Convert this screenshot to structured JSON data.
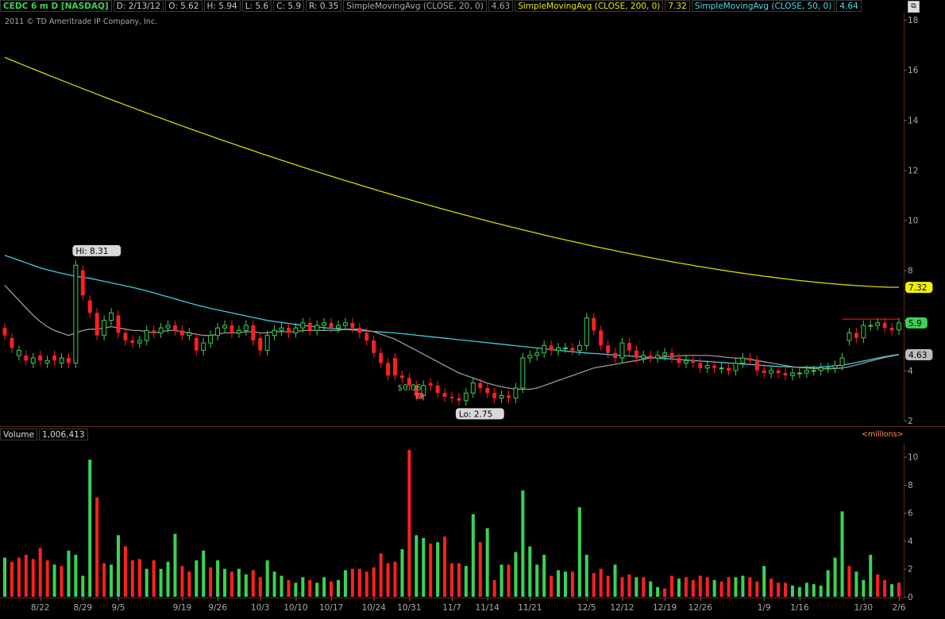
{
  "header": {
    "symbol": "CEDC 6 m D [NASDAQ]",
    "date": "D: 2/13/12",
    "open": "O: 5.62",
    "high": "H: 5.94",
    "low": "L: 5.6",
    "close": "C: 5.9",
    "range": "R: 0.35",
    "sma20_label": "SimpleMovingAvg (CLOSE, 20, 0)",
    "sma20_value": "4.63",
    "sma200_label": "SimpleMovingAvg (CLOSE, 200, 0)",
    "sma200_value": "7.32",
    "sma50_label": "SimpleMovingAvg (CLOSE, 50, 0)",
    "sma50_value": "4.64"
  },
  "copyright": "2011 © TD Ameritrade IP Company, Inc.",
  "volume_header": {
    "label": "Volume",
    "value": "1,006,413",
    "units": "<millions>"
  },
  "colors": {
    "up": "#39d353",
    "down": "#ff2020",
    "sma20": "#9a9a9a",
    "sma50": "#3ad0e0",
    "sma200": "#d8d800",
    "background": "#000000",
    "grid": "#5a2a10"
  },
  "chart_data": [
    {
      "type": "candlestick",
      "title": "CEDC 6 m D [NASDAQ]",
      "ylim": [
        2,
        18
      ],
      "yticks": [
        2,
        4,
        6,
        8,
        10,
        12,
        14,
        16,
        18
      ],
      "xticks": [
        "8/22",
        "8/29",
        "9/5",
        "9/19",
        "9/26",
        "10/3",
        "10/10",
        "10/17",
        "10/24",
        "10/31",
        "11/7",
        "11/14",
        "11/21",
        "12/5",
        "12/12",
        "12/19",
        "12/26",
        "1/9",
        "1/16",
        "1/30",
        "2/6"
      ],
      "annotations": {
        "hi": "Hi: 8.31",
        "lo": "Lo: 2.75",
        "dividend": "$0.06",
        "last_price": "5.9",
        "sma200_last": "7.32",
        "sma20_last": "4.63"
      },
      "closes": [
        5.4,
        4.9,
        4.8,
        4.4,
        4.5,
        4.4,
        4.4,
        4.4,
        4.5,
        4.3,
        8.2,
        7.0,
        6.3,
        5.4,
        6.0,
        6.3,
        5.5,
        5.2,
        5.1,
        5.2,
        5.6,
        5.5,
        5.7,
        5.8,
        5.6,
        5.4,
        5.5,
        4.8,
        5.1,
        5.4,
        5.7,
        5.8,
        5.5,
        5.6,
        5.8,
        5.2,
        4.8,
        5.4,
        5.6,
        5.7,
        5.5,
        5.7,
        5.9,
        5.6,
        5.8,
        5.9,
        5.7,
        5.8,
        5.9,
        5.7,
        5.5,
        5.2,
        4.7,
        4.3,
        3.8,
        3.8,
        3.7,
        3.4,
        3.0,
        3.4,
        3.4,
        3.1,
        2.95,
        2.9,
        2.8,
        3.1,
        3.5,
        3.3,
        3.1,
        2.9,
        3.0,
        2.9,
        3.3,
        4.5,
        4.6,
        4.7,
        5.0,
        4.8,
        4.9,
        4.9,
        4.8,
        5.0,
        6.1,
        5.6,
        5.0,
        4.7,
        4.5,
        5.1,
        4.8,
        4.5,
        4.6,
        4.5,
        4.6,
        4.7,
        4.5,
        4.3,
        4.4,
        4.3,
        4.1,
        4.2,
        4.1,
        4.1,
        4.0,
        4.3,
        4.5,
        4.4,
        4.0,
        3.9,
        4.0,
        3.9,
        3.8,
        3.9,
        3.9,
        4.0,
        4.0,
        4.1,
        4.1,
        4.2,
        4.5,
        5.5,
        5.3,
        5.8,
        5.8,
        5.9,
        5.7,
        5.6,
        5.9
      ],
      "opens": [
        5.7,
        5.3,
        4.6,
        4.6,
        4.3,
        4.6,
        4.3,
        4.6,
        4.3,
        4.5,
        4.3,
        8.0,
        6.8,
        6.3,
        5.4,
        6.0,
        6.2,
        5.5,
        5.2,
        5.1,
        5.2,
        5.6,
        5.5,
        5.7,
        5.8,
        5.6,
        5.4,
        5.3,
        4.8,
        5.1,
        5.4,
        5.7,
        5.8,
        5.5,
        5.6,
        5.8,
        5.3,
        4.8,
        5.4,
        5.6,
        5.7,
        5.5,
        5.7,
        5.9,
        5.6,
        5.8,
        5.9,
        5.7,
        5.8,
        5.9,
        5.7,
        5.5,
        5.2,
        4.7,
        4.3,
        4.5,
        3.8,
        3.7,
        3.4,
        3.0,
        3.5,
        3.4,
        3.1,
        2.95,
        2.9,
        2.8,
        3.1,
        3.5,
        3.3,
        3.1,
        2.9,
        3.0,
        2.9,
        3.3,
        4.5,
        4.6,
        4.7,
        5.0,
        4.8,
        4.9,
        4.9,
        4.8,
        5.0,
        6.1,
        5.6,
        5.0,
        4.7,
        4.5,
        5.1,
        4.8,
        4.5,
        4.6,
        4.5,
        4.6,
        4.7,
        4.5,
        4.3,
        4.4,
        4.3,
        4.1,
        4.2,
        4.1,
        4.1,
        4.0,
        4.3,
        4.5,
        4.4,
        4.0,
        3.9,
        4.0,
        3.9,
        3.8,
        3.9,
        3.9,
        4.0,
        4.0,
        4.1,
        4.1,
        4.2,
        5.2,
        5.5,
        5.3,
        5.8,
        5.8,
        5.9,
        5.7,
        5.62
      ],
      "highs_offset": 0.2,
      "sma20": [
        7.4,
        7.1,
        6.8,
        6.5,
        6.2,
        5.95,
        5.75,
        5.6,
        5.5,
        5.4,
        5.5,
        5.6,
        5.65,
        5.65,
        5.7,
        5.75,
        5.7,
        5.65,
        5.6,
        5.6,
        5.55,
        5.5,
        5.55,
        5.6,
        5.6,
        5.55,
        5.5,
        5.45,
        5.4,
        5.4,
        5.45,
        5.5,
        5.5,
        5.5,
        5.55,
        5.55,
        5.5,
        5.5,
        5.55,
        5.55,
        5.55,
        5.55,
        5.6,
        5.6,
        5.6,
        5.6,
        5.6,
        5.6,
        5.65,
        5.65,
        5.65,
        5.6,
        5.55,
        5.45,
        5.35,
        5.25,
        5.1,
        4.95,
        4.8,
        4.65,
        4.5,
        4.35,
        4.2,
        4.05,
        3.9,
        3.8,
        3.7,
        3.6,
        3.5,
        3.42,
        3.35,
        3.3,
        3.25,
        3.25,
        3.25,
        3.3,
        3.4,
        3.5,
        3.6,
        3.7,
        3.8,
        3.9,
        4.0,
        4.1,
        4.15,
        4.2,
        4.25,
        4.3,
        4.35,
        4.4,
        4.45,
        4.5,
        4.52,
        4.55,
        4.57,
        4.58,
        4.6,
        4.6,
        4.6,
        4.6,
        4.58,
        4.55,
        4.52,
        4.5,
        4.48,
        4.45,
        4.4,
        4.35,
        4.3,
        4.25,
        4.2,
        4.15,
        4.12,
        4.1,
        4.08,
        4.07,
        4.07,
        4.08,
        4.1,
        4.15,
        4.22,
        4.3,
        4.38,
        4.45,
        4.52,
        4.58,
        4.63
      ],
      "sma50": [
        8.6,
        8.5,
        8.4,
        8.3,
        8.2,
        8.1,
        8.02,
        7.95,
        7.88,
        7.82,
        7.76,
        7.72,
        7.68,
        7.62,
        7.56,
        7.5,
        7.44,
        7.38,
        7.32,
        7.25,
        7.18,
        7.1,
        7.02,
        6.94,
        6.86,
        6.78,
        6.7,
        6.62,
        6.55,
        6.48,
        6.42,
        6.36,
        6.3,
        6.24,
        6.18,
        6.12,
        6.06,
        6.0,
        5.96,
        5.92,
        5.88,
        5.84,
        5.8,
        5.77,
        5.74,
        5.71,
        5.68,
        5.66,
        5.64,
        5.62,
        5.6,
        5.58,
        5.56,
        5.54,
        5.52,
        5.5,
        5.47,
        5.44,
        5.41,
        5.38,
        5.35,
        5.32,
        5.29,
        5.26,
        5.23,
        5.2,
        5.17,
        5.14,
        5.11,
        5.08,
        5.05,
        5.02,
        4.99,
        4.96,
        4.93,
        4.9,
        4.87,
        4.84,
        4.81,
        4.78,
        4.75,
        4.72,
        4.7,
        4.68,
        4.66,
        4.64,
        4.62,
        4.6,
        4.58,
        4.56,
        4.54,
        4.52,
        4.5,
        4.48,
        4.46,
        4.44,
        4.42,
        4.4,
        4.38,
        4.36,
        4.34,
        4.32,
        4.3,
        4.28,
        4.26,
        4.24,
        4.22,
        4.2,
        4.18,
        4.16,
        4.15,
        4.14,
        4.13,
        4.13,
        4.13,
        4.14,
        4.16,
        4.18,
        4.22,
        4.26,
        4.32,
        4.38,
        4.44,
        4.5,
        4.55,
        4.6,
        4.64
      ],
      "sma200": [
        16.5,
        7.32
      ]
    },
    {
      "type": "bar",
      "title": "Volume",
      "ylabel": "millions",
      "ylim": [
        0,
        11
      ],
      "yticks": [
        0,
        2,
        4,
        6,
        8,
        10
      ],
      "values": [
        2.8,
        2.5,
        2.8,
        3.0,
        2.7,
        3.5,
        2.6,
        2.3,
        2.2,
        3.3,
        3.0,
        1.5,
        9.8,
        7.1,
        2.4,
        2.3,
        4.4,
        3.6,
        2.6,
        2.7,
        2.0,
        2.6,
        2.0,
        2.5,
        4.5,
        2.2,
        1.8,
        2.6,
        3.3,
        2.1,
        2.6,
        2.0,
        1.8,
        2.0,
        1.6,
        1.9,
        1.4,
        2.6,
        1.8,
        1.5,
        1.2,
        1.0,
        1.4,
        1.2,
        1.0,
        1.4,
        1.1,
        1.2,
        1.9,
        2.0,
        2.0,
        1.8,
        2.1,
        3.1,
        2.4,
        2.5,
        3.4,
        10.5,
        4.4,
        4.2,
        3.8,
        3.9,
        4.3,
        2.4,
        2.4,
        2.2,
        5.9,
        3.9,
        4.9,
        1.2,
        2.3,
        2.3,
        3.2,
        7.6,
        3.6,
        2.3,
        3.0,
        1.5,
        1.9,
        1.8,
        1.8,
        6.4,
        3.0,
        1.7,
        2.0,
        1.5,
        2.3,
        1.4,
        1.6,
        1.4,
        1.4,
        1.1,
        0.7,
        0.6,
        1.5,
        1.3,
        1.4,
        1.2,
        1.5,
        1.4,
        1.2,
        1.1,
        1.4,
        1.4,
        1.5,
        1.4,
        1.1,
        2.2,
        1.3,
        1.0,
        1.0,
        0.8,
        0.7,
        1.0,
        0.9,
        0.8,
        1.9,
        2.8,
        6.1,
        2.2,
        1.8,
        1.2,
        3.0,
        1.6,
        1.2,
        0.9,
        1.0
      ],
      "up": [
        1,
        0,
        0,
        0,
        0,
        0,
        0,
        1,
        0,
        1,
        1,
        1,
        1,
        0,
        0,
        1,
        1,
        0,
        0,
        0,
        1,
        0,
        1,
        1,
        1,
        0,
        0,
        1,
        1,
        0,
        1,
        1,
        0,
        1,
        1,
        0,
        0,
        1,
        1,
        1,
        0,
        1,
        1,
        0,
        1,
        1,
        0,
        1,
        1,
        0,
        0,
        0,
        0,
        0,
        0,
        0,
        1,
        0,
        1,
        1,
        0,
        1,
        0,
        0,
        0,
        1,
        1,
        0,
        1,
        0,
        1,
        0,
        1,
        1,
        1,
        1,
        1,
        0,
        1,
        1,
        0,
        1,
        1,
        0,
        0,
        0,
        1,
        0,
        0,
        1,
        0,
        1,
        1,
        0,
        0,
        1,
        0,
        0,
        0,
        0,
        1,
        0,
        0,
        1,
        1,
        0,
        0,
        1,
        0,
        0,
        0,
        1,
        1,
        1,
        1,
        1,
        1,
        1,
        1,
        0,
        1,
        1,
        1,
        0,
        0,
        1
      ]
    }
  ]
}
